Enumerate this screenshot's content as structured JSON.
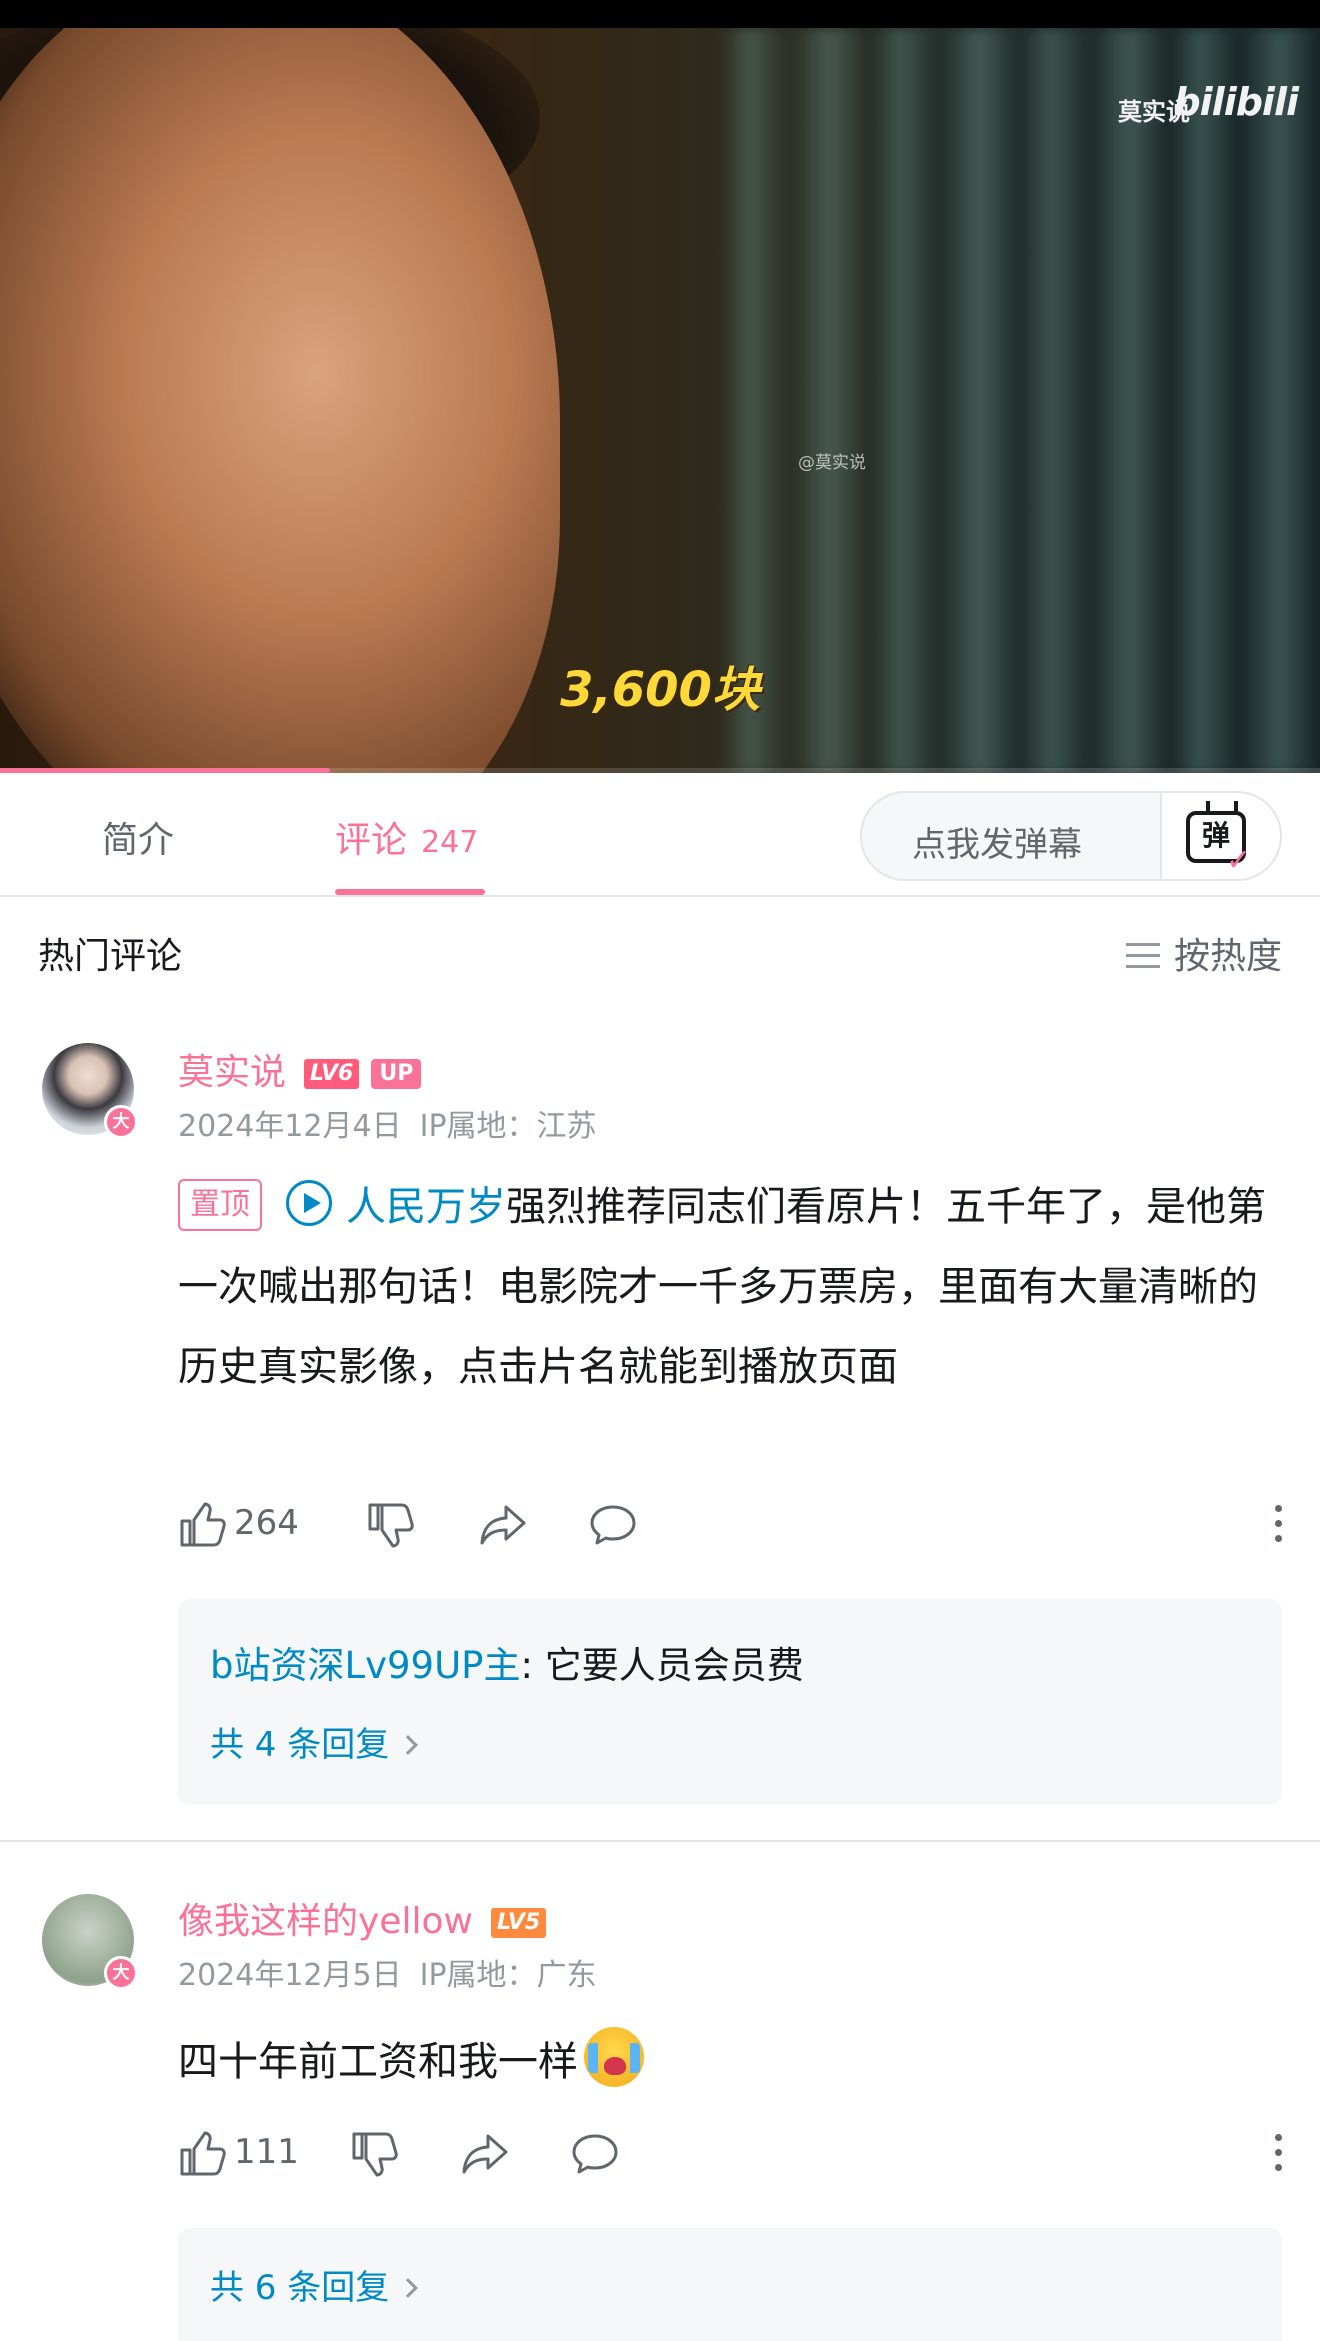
{
  "video": {
    "watermark_text": "莫实说",
    "watermark_logo": "bilibili",
    "watermark_small": "@莫实说",
    "subtitle": "3,600块",
    "progress_fraction": 0.25
  },
  "tabs": {
    "intro_label": "简介",
    "comments_label": "评论",
    "comments_count": "247",
    "danmaku_placeholder": "点我发弹幕",
    "danmaku_icon_char": "弹"
  },
  "sort": {
    "section_title": "热门评论",
    "sort_label": "按热度"
  },
  "comments": [
    {
      "username": "莫实说",
      "level": "LV6",
      "up_tag": "UP",
      "avatar_badge": "大",
      "date": "2024年12月4日",
      "ip": "IP属地：江苏",
      "pin_tag": "置顶",
      "video_link": "人民万岁",
      "text": "强烈推荐同志们看原片！五千年了，是他第一次喊出那句话！电影院才一千多万票房，里面有大量清晰的历史真实影像，点击片名就能到播放页面",
      "likes": "264",
      "reply_preview_user": "b站资深Lv99UP主",
      "reply_preview_text": ": 它要人员会员费",
      "reply_total": "共 4 条回复"
    },
    {
      "username": "像我这样的yellow",
      "level": "LV5",
      "avatar_badge": "大",
      "date": "2024年12月5日",
      "ip": "IP属地：广东",
      "text": "四十年前工资和我一样",
      "emoji": "crying-face",
      "likes": "111",
      "reply_total": "共 6 条回复"
    }
  ],
  "colors": {
    "accent_pink": "#fb7299",
    "link_blue": "#008ac5",
    "subtitle_yellow": "#ffd83a"
  }
}
